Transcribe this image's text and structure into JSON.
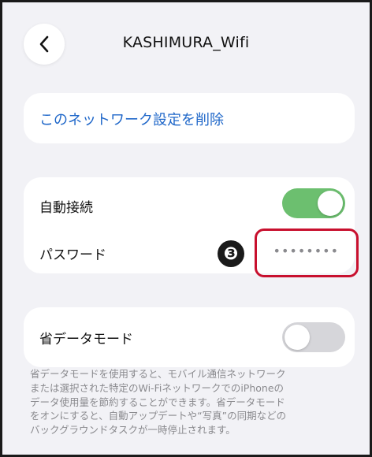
{
  "header": {
    "title": "KASHIMURA_Wifi",
    "back_icon": "chevron-left-icon"
  },
  "forget_network": {
    "label": "このネットワーク設定を削除",
    "color": "#1f67c9"
  },
  "settings": {
    "auto_join": {
      "label": "自動接続",
      "enabled": true
    },
    "password": {
      "label": "パスワード",
      "value": "••••••••"
    }
  },
  "annotation": {
    "marker": "❸",
    "highlight_color": "#c8102e"
  },
  "low_data_mode": {
    "label": "省データモード",
    "enabled": false,
    "description": "省データモードを使用すると、モバイル通信ネットワーク\nまたは選択された特定のWi-FiネットワークでのiPhoneの\nデータ使用量を節約することができます。省データモード\nをオンにすると、自動アップデートや“写真”の同期などの\nバックグラウンドタスクが一時停止されます。"
  },
  "colors": {
    "background": "#f2f2f6",
    "toggle_on": "#6cbf6f",
    "toggle_off": "#d6d6da"
  }
}
